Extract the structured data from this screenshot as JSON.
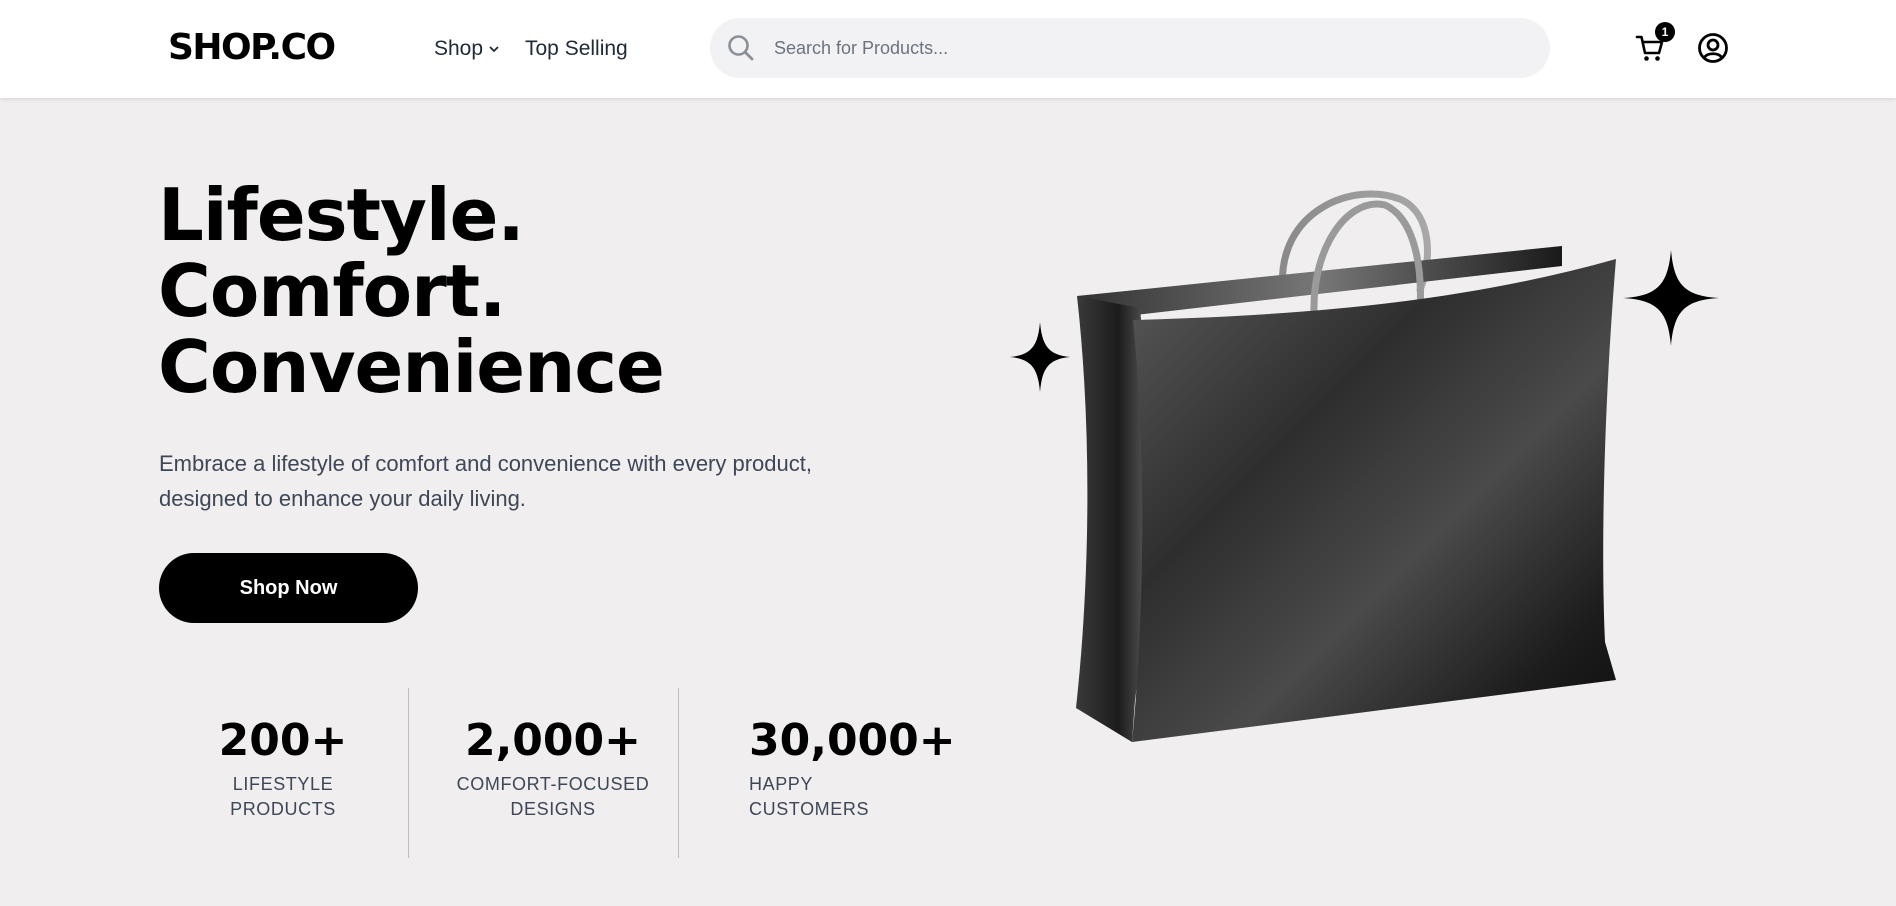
{
  "header": {
    "logo": "SHOP.CO",
    "nav": {
      "shop_label": "Shop",
      "top_selling_label": "Top Selling"
    },
    "search": {
      "placeholder": "Search for Products..."
    },
    "cart_count": "1"
  },
  "hero": {
    "headline": [
      "Lifestyle.",
      "Comfort.",
      "Convenience"
    ],
    "description_lines": [
      "Embrace a lifestyle of comfort and convenience with every product,",
      "designed to enhance your daily living."
    ],
    "cta_label": "Shop Now"
  },
  "stats": [
    {
      "value": "200+",
      "label_lines": [
        "LIFESTYLE",
        "PRODUCTS"
      ]
    },
    {
      "value": "2,000+",
      "label_lines": [
        "COMFORT-FOCUSED",
        "DESIGNS"
      ]
    },
    {
      "value": "30,000+",
      "label_lines": [
        "HAPPY",
        "CUSTOMERS"
      ]
    }
  ],
  "icons": {
    "search": "search-icon",
    "chevron": "chevron-down-icon",
    "cart": "cart-icon",
    "user": "user-account-icon",
    "sparkle": "sparkle-icon",
    "bag": "shopping-bag-illustration"
  },
  "colors": {
    "page_background": "#f0eeef",
    "header_background": "#ffffff",
    "button_background": "#000000",
    "button_text": "#ffffff",
    "body_text": "#3e4757"
  }
}
